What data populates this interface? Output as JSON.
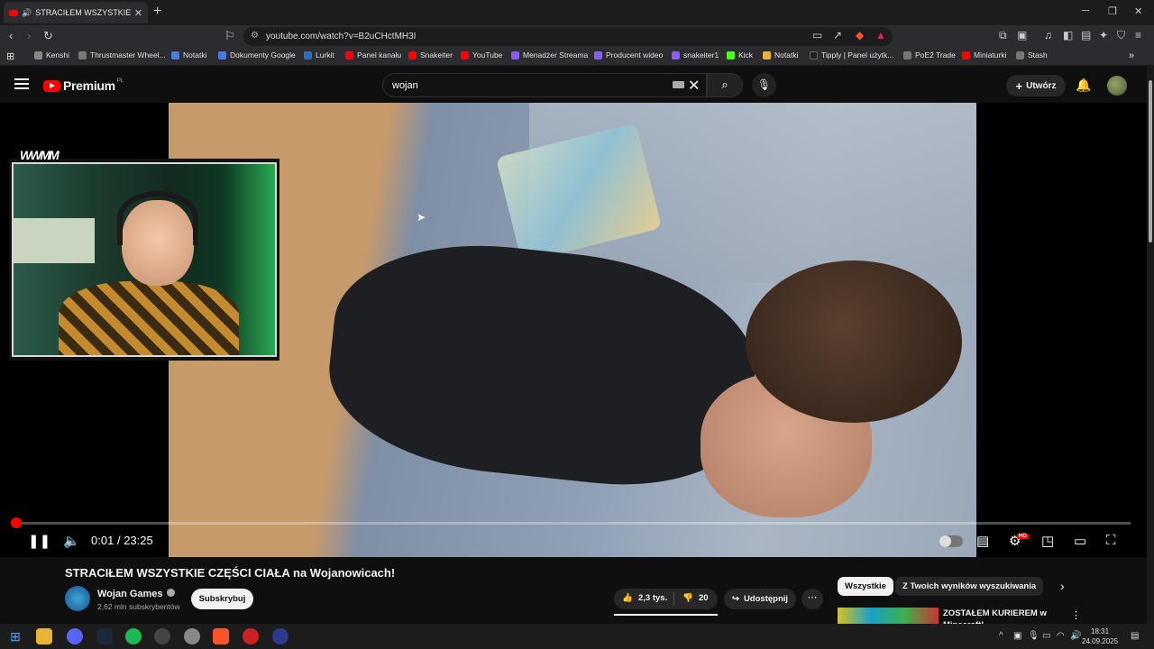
{
  "browser": {
    "tab_title": "STRACIŁEM WSZYSTKIE CZĘŚ",
    "url": "youtube.com/watch?v=B2uCHctMH3I"
  },
  "bookmarks": [
    {
      "label": "Kenshi",
      "color": "#888888"
    },
    {
      "label": "Thrustmaster Wheel...",
      "color": "#777777"
    },
    {
      "label": "Notatki",
      "color": "#4a7be0"
    },
    {
      "label": "Dokumenty Google",
      "color": "#4a7be0"
    },
    {
      "label": "Lurkit",
      "color": "#2f6db5"
    },
    {
      "label": "Panel kanału",
      "color": "#ff0000"
    },
    {
      "label": "Snakeiter",
      "color": "#ff0000"
    },
    {
      "label": "YouTube",
      "color": "#ff0000"
    },
    {
      "label": "Menadżer Streama",
      "color": "#8b5cf6"
    },
    {
      "label": "Producent wideo",
      "color": "#8b5cf6"
    },
    {
      "label": "snakeiter1",
      "color": "#8b5cf6"
    },
    {
      "label": "Kick",
      "color": "#53fc18"
    },
    {
      "label": "Notatki",
      "color": "#e8b339"
    },
    {
      "label": "Tipply | Panel użytk...",
      "color": "#222222"
    },
    {
      "label": "PoE2 Trade",
      "color": "#777777"
    },
    {
      "label": "Miniaturki",
      "color": "#ff0000"
    },
    {
      "label": "Stash",
      "color": "#777777"
    }
  ],
  "youtube": {
    "logo_text": "Premium",
    "logo_region": "PL",
    "search_value": "wojan",
    "create_label": "Utwórz"
  },
  "player": {
    "time_current": "0:01",
    "time_total": "23:25",
    "time_separator": "/",
    "progress": 0.01,
    "hd_badge": "HD",
    "overlay_logo": "WWMM"
  },
  "video": {
    "title": "STRACIŁEM WSZYSTKIE CZĘŚCI CIAŁA na Wojanowicach!",
    "channel": "Wojan Games",
    "subscribers": "2,62 mln subskrybentów",
    "subscribe_label": "Subskrybuj",
    "likes": "2,3 tys.",
    "dislikes": "20",
    "share_label": "Udostępnij"
  },
  "sidebar": {
    "chips": [
      "Wszystkie",
      "Z Twoich wyników wyszukiwania"
    ],
    "rec_title": "ZOSTAŁEM KURIEREM w Minecraft!"
  },
  "system": {
    "time": "18:31",
    "date": "24.09.2025"
  }
}
